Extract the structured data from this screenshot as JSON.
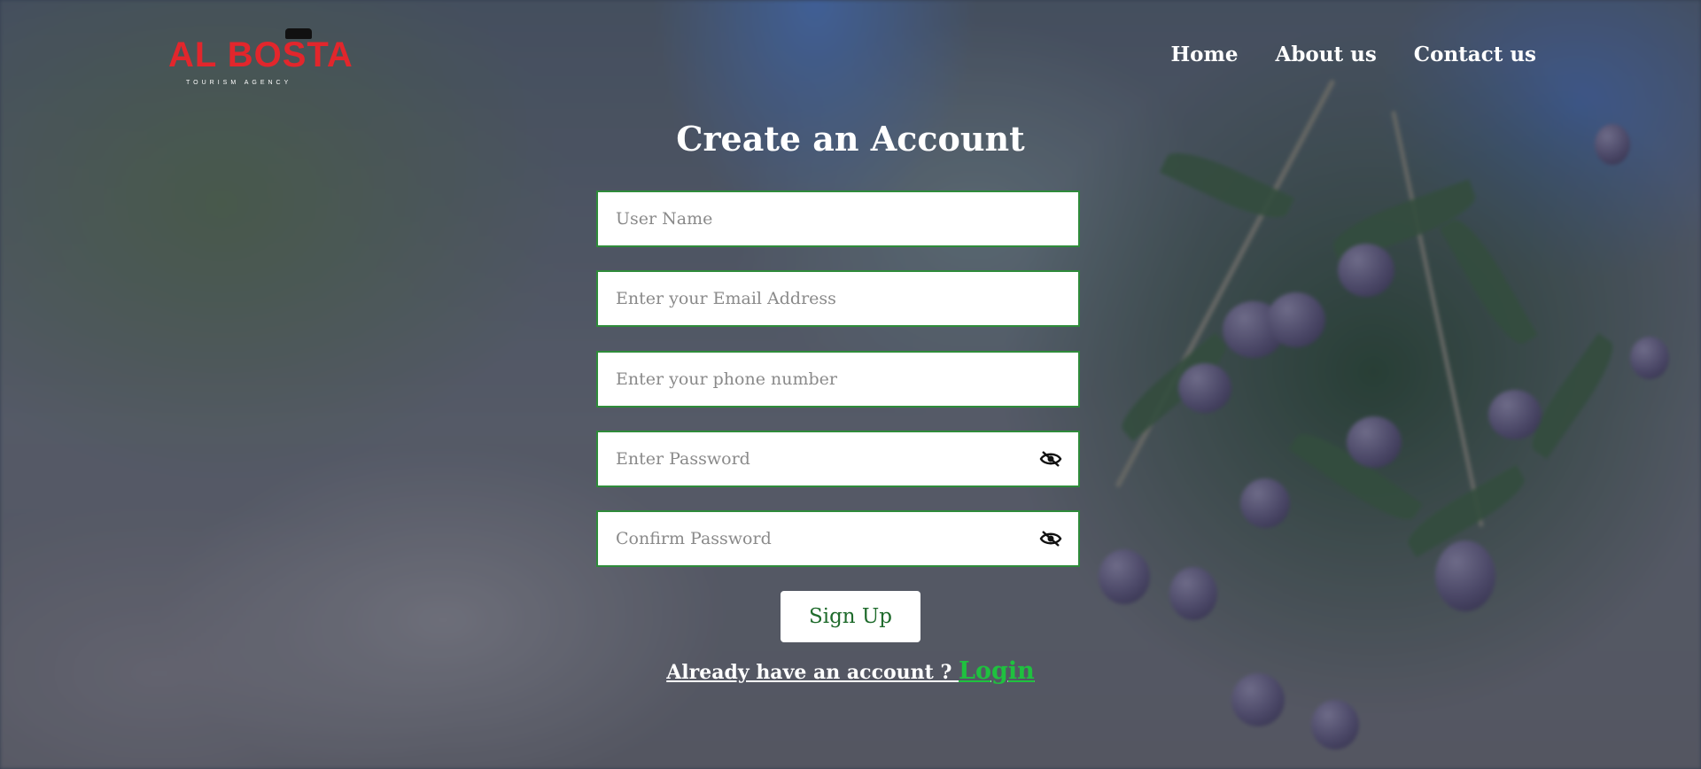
{
  "brand": {
    "name": "AL BOSTA",
    "tagline": "TOURISM AGENCY",
    "color": "#e2262c"
  },
  "nav": {
    "items": [
      {
        "label": "Home"
      },
      {
        "label": "About us"
      },
      {
        "label": "Contact us"
      }
    ]
  },
  "form": {
    "title": "Create an Account",
    "username_placeholder": "User Name",
    "email_placeholder": "Enter your Email Address",
    "phone_placeholder": "Enter your phone number",
    "password_placeholder": "Enter Password",
    "confirm_placeholder": "Confirm Password",
    "submit_label": "Sign Up",
    "already_text": "Already have an account ? ",
    "login_label": "Login",
    "border_color": "#2e8b3a",
    "login_color": "#1fc13f"
  },
  "icons": {
    "password_toggle": "eye-off-icon"
  }
}
